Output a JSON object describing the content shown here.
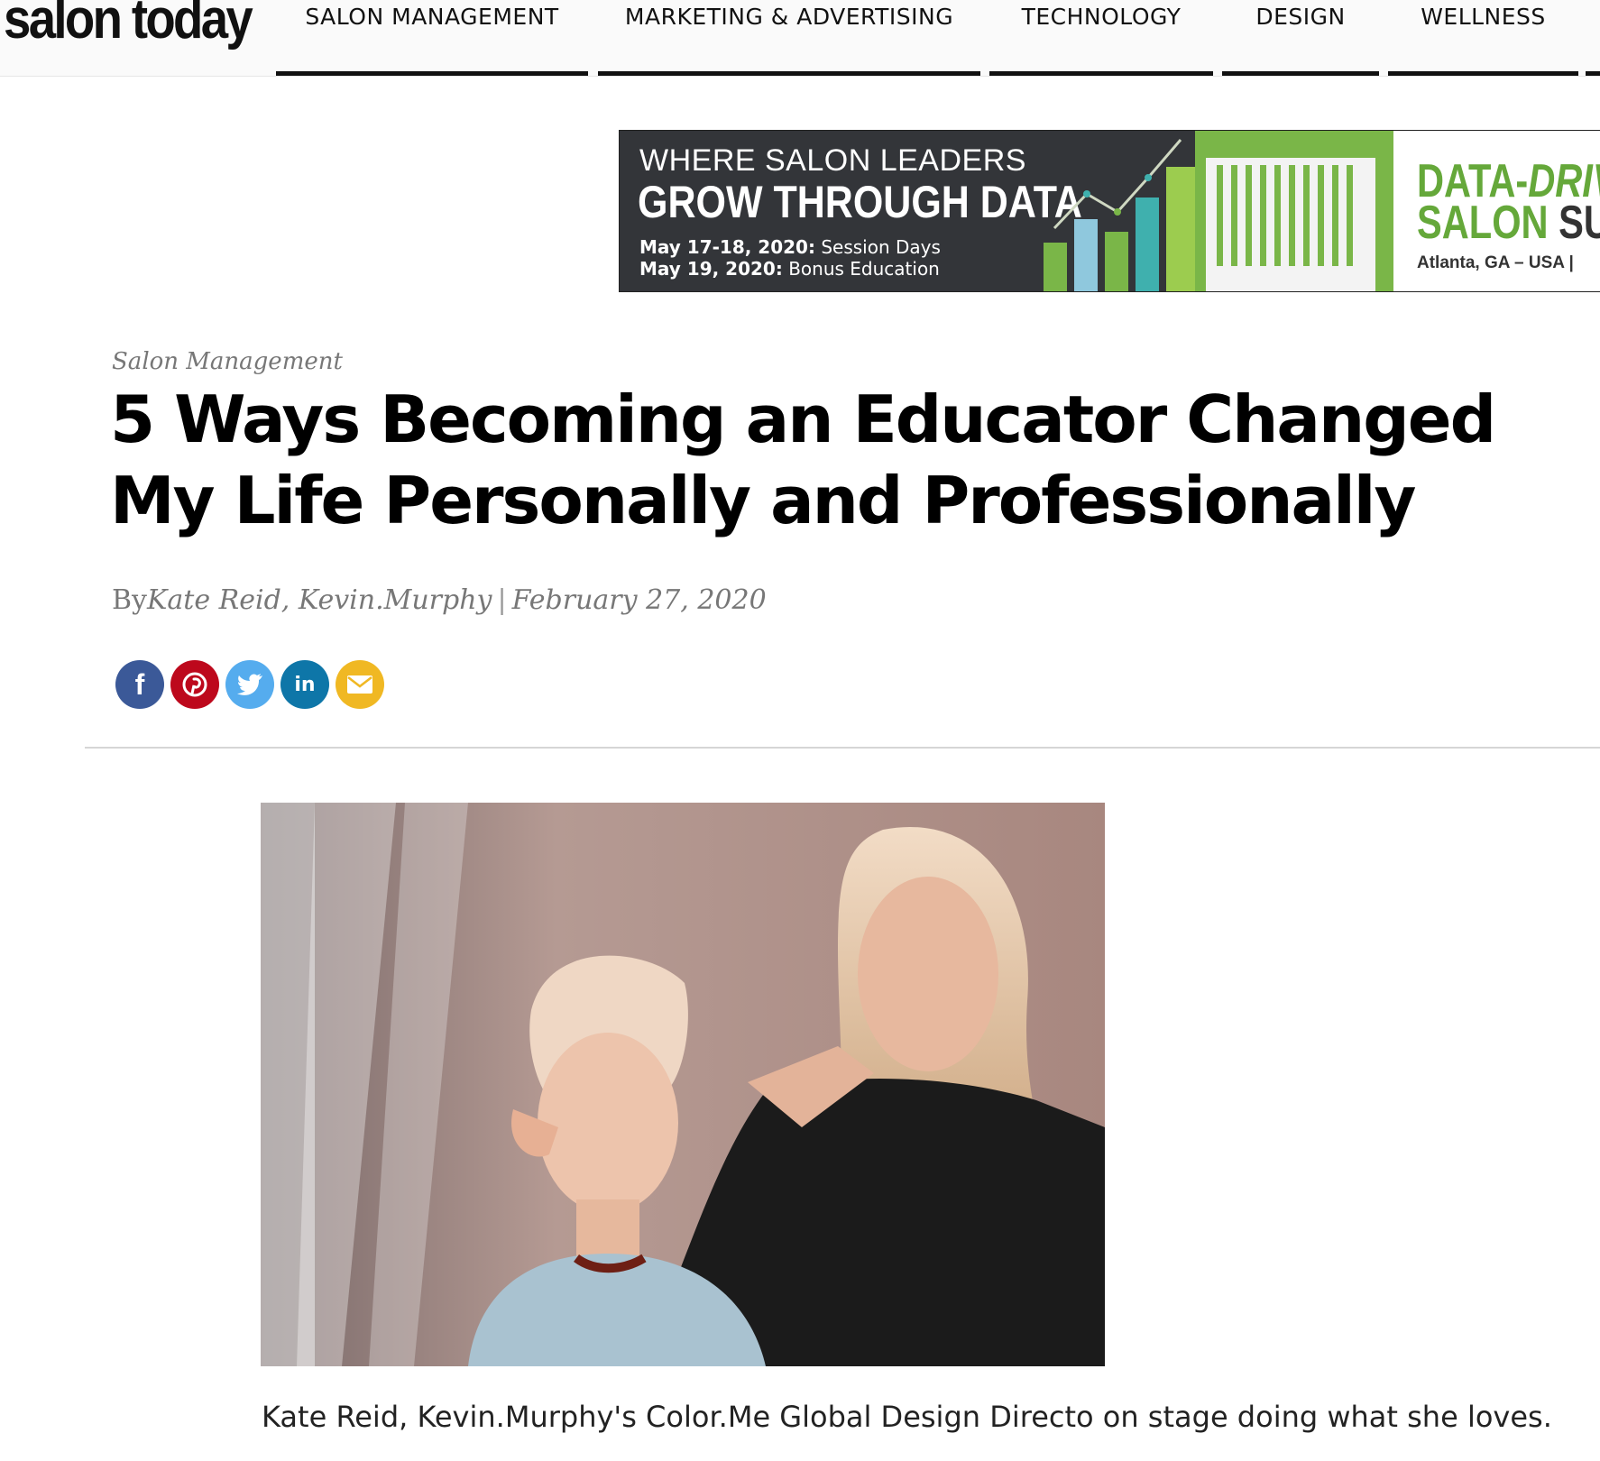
{
  "header": {
    "logo_text": "salon today",
    "nav": [
      {
        "label": "SALON MANAGEMENT"
      },
      {
        "label": "MARKETING & ADVERTISING"
      },
      {
        "label": "TECHNOLOGY"
      },
      {
        "label": "DESIGN"
      },
      {
        "label": "WELLNESS"
      }
    ]
  },
  "ad": {
    "line1": "WHERE SALON LEADERS",
    "line2": "GROW THROUGH DATA",
    "date1_bold": "May 17-18, 2020:",
    "date1_rest": " Session Days",
    "date2_bold": "May 19, 2020:",
    "date2_rest": " Bonus Education",
    "right_title1_a": "DATA-",
    "right_title1_b": "DRIVE",
    "right_title2_a": "SALON ",
    "right_title2_b": "SUM",
    "location": "Atlanta, GA – USA  |",
    "colors": {
      "dark": "#333539",
      "green": "#7ab648",
      "teal": "#3fb0ae",
      "lightblue": "#8fc8dd"
    }
  },
  "article": {
    "section": "Salon Management",
    "title": "5 Ways Becoming an Educator Changed My Life Personally and Professionally",
    "by_prefix": "By",
    "authors": "Kate Reid, Kevin.Murphy",
    "separator": "|",
    "date": "February 27, 2020",
    "share_buttons": [
      {
        "name": "facebook-icon",
        "glyph": "f",
        "color": "#3b5998"
      },
      {
        "name": "pinterest-icon",
        "glyph": "P",
        "color": "#bd081c"
      },
      {
        "name": "twitter-icon",
        "glyph": "t",
        "color": "#55acee"
      },
      {
        "name": "linkedin-icon",
        "glyph": "in",
        "color": "#0e76a8"
      },
      {
        "name": "email-icon",
        "glyph": "✉",
        "color": "#f0b823"
      }
    ],
    "caption": "Kate Reid, Kevin.Murphy's Color.Me Global Design Directo on stage doing what she loves."
  }
}
